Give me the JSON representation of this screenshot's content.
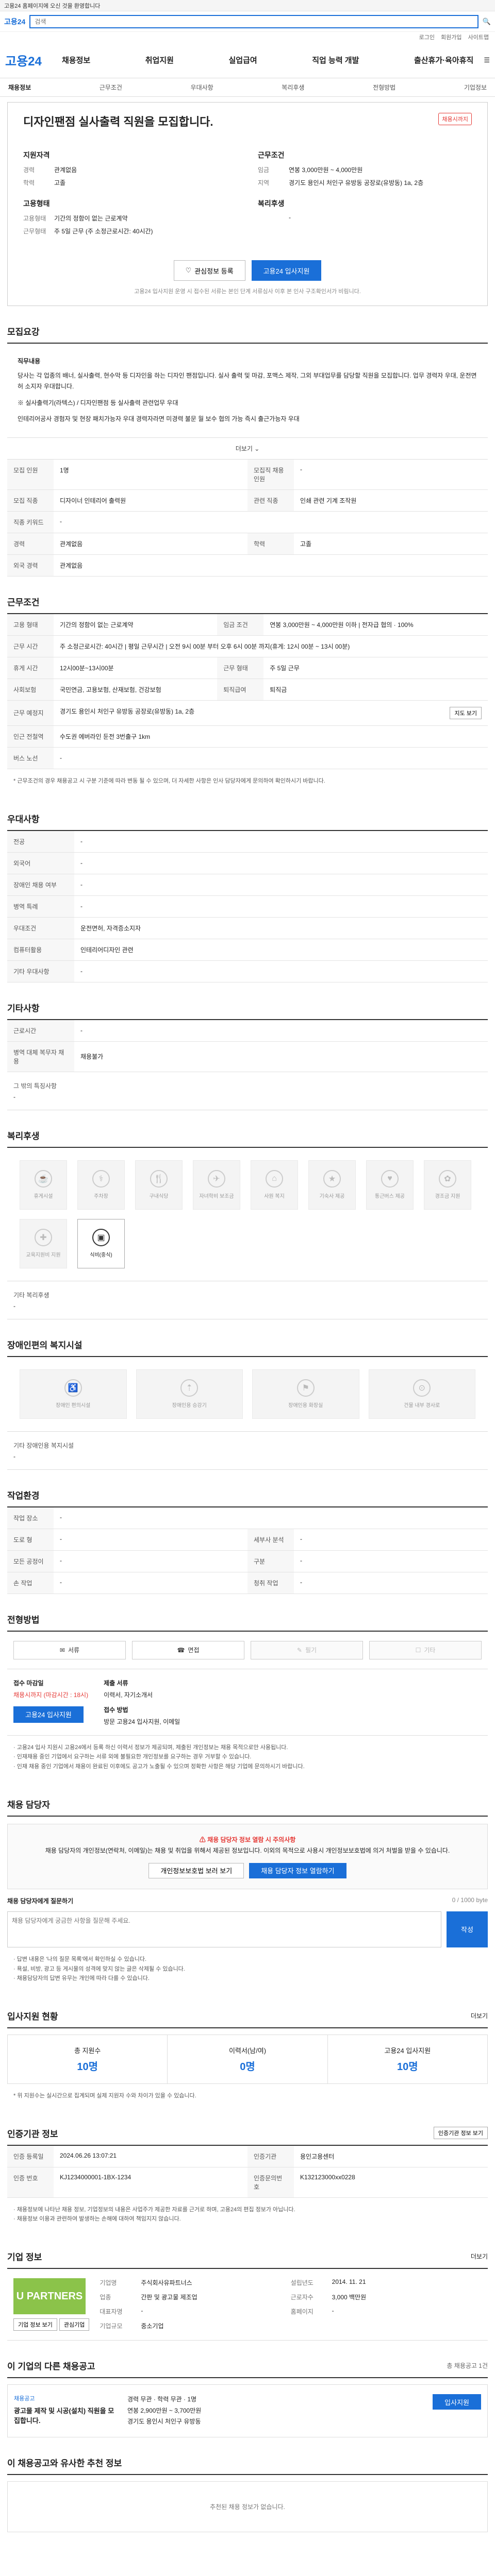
{
  "topbar": {
    "text": "고용24 홈페이지에 오신 것을 환영합니다"
  },
  "search": {
    "logo": "고용24",
    "placeholder": "검색"
  },
  "util": [
    "로그인",
    "회원가입",
    "사이트맵"
  ],
  "gnb": {
    "logo": "고용24",
    "menu": [
      "채용정보",
      "취업지원",
      "실업급여",
      "직업 능력 개발",
      "출산휴가·육아휴직"
    ]
  },
  "lnb": [
    "채용정보",
    "근무조건",
    "우대사항",
    "복리후생",
    "전형방법",
    "기업정보"
  ],
  "hero": {
    "title": "디자인팬점 실사출력 직원을 모집합니다.",
    "badge": "채용시까지",
    "left_title": "지원자격",
    "left": [
      {
        "k": "경력",
        "v": "관계없음"
      },
      {
        "k": "학력",
        "v": "고졸"
      }
    ],
    "left2_title": "고용형태",
    "left2": [
      {
        "k": "고용형태",
        "v": "기간의 정함이 없는 근로계약"
      },
      {
        "k": "근무형태",
        "v": "주 5일 근무 (주 소정근로시간: 40시간)"
      }
    ],
    "right_title": "근무조건",
    "right": [
      {
        "k": "임금",
        "v": "연봉 3,000만원 ~ 4,000만원"
      },
      {
        "k": "지역",
        "v": "경기도 용인시 처인구 유방동 공장로(유방동) 1a, 2층"
      }
    ],
    "right2_title": "복리후생",
    "right2": [
      {
        "k": "",
        "v": "-"
      }
    ],
    "btn_scrap": "관심정보 등록",
    "btn_apply": "고용24 입사지원",
    "note": "고용24 입사지원 운영 시 접수된 서류는 본인 단계 서류심사 이후 본 인사 구조확인서가 비림니다."
  },
  "recruit": {
    "title": "모집요강",
    "duty_label": "직무내용",
    "duty": "당사는 각 업종의 배너, 실사출력, 현수막 등 디자인을 하는 디자인 팬점입니다. 실사 출력 및 마감, 포맥스 제작, 그외 부대업무를 담당할 직원을 모집합니다. 업무 경력자 우대, 운전면허 소지자 우대합니다.",
    "duty2": "※ 실사출력기(라텍스) / 디자인팬점 등 실사출력 관련업무 우대",
    "duty3": "인테리어공사 경험자 및 현장 패치가능자 우대 경력자라면 미경력 불문 월 보수 협의 가능 즉시 출근가능자 우대",
    "more": "더보기",
    "rows": [
      [
        "모집 인원",
        "1명",
        "모집직 채용 인원",
        "-"
      ],
      [
        "모집 직종",
        "디자이너 인테리어 출력원",
        "관련 직종",
        "인쇄 관련 기계 조작원"
      ],
      [
        "직종 키워드",
        "-",
        "",
        ""
      ],
      [
        "경력",
        "관계없음",
        "학력",
        "고졸"
      ],
      [
        "외국 경력",
        "관계없음",
        "",
        ""
      ]
    ]
  },
  "work": {
    "title": "근무조건",
    "rows": [
      {
        "k": "고용 형태",
        "v": "기간의 정함이 없는 근로계약",
        "k2": "임금 조건",
        "v2": "연봉 3,000만원 ~ 4,000만원 이하 | 전자급 협의 · 100%"
      },
      {
        "k": "근무 시간",
        "v": "주 소정근로시간: 40시간 | 평일 근무시간 | 오전 9시 00분 부터 오후 6시 00분 까지(휴게: 12시 00분 ~ 13시 00분)"
      },
      {
        "k": "휴게 시간",
        "v": "12시00분~13시00분",
        "k2": "근무 형태",
        "v2": "주 5일 근무"
      },
      {
        "k": "사회보험",
        "v": "국민연금, 고용보험, 산재보험, 건강보험",
        "k2": "퇴직급여",
        "v2": "퇴직금"
      },
      {
        "k": "근무 예정지",
        "v": "경기도 용인시 처인구 유방동 공장로(유방동) 1a, 2층",
        "btn": "지도 보기"
      },
      {
        "k": "인근 전철역",
        "v": "수도권 에버라인 둔전 3번출구 1km"
      },
      {
        "k": "버스 노선",
        "v": "-"
      }
    ],
    "note": "* 근무조건의 경우 채용공고 시 구분 기준에 따라 변동 될 수 있으며, 더 자세한 사항은 인사 담당자에게 문의하여 확인하시기 바랍니다."
  },
  "pref": {
    "title": "우대사항",
    "rows": [
      [
        "전공",
        "-"
      ],
      [
        "외국어",
        "-"
      ],
      [
        "장애인 채용 여부",
        "-"
      ],
      [
        "병역 특례",
        "-"
      ],
      [
        "우대조건",
        "운전면허, 자격증소지자"
      ],
      [
        "컴퓨터활용",
        "인테리어디자인 관련"
      ],
      [
        "기타 우대사항",
        "-"
      ]
    ]
  },
  "etc": {
    "title": "기타사항",
    "rows": [
      [
        "근로시간",
        "-"
      ],
      [
        "병역 대체 복무자 채용",
        "채용불가"
      ],
      [
        "그 밖의 특징사항",
        "-"
      ]
    ]
  },
  "welfare": {
    "title": "복리후생",
    "tiles": [
      {
        "icon": "☕",
        "label": "휴게시설"
      },
      {
        "icon": "⚕",
        "label": "주차장"
      },
      {
        "icon": "🍴",
        "label": "구내식당"
      },
      {
        "icon": "✈",
        "label": "자녀학비 보조금"
      },
      {
        "icon": "⌂",
        "label": "사원 복지"
      },
      {
        "icon": "★",
        "label": "기숙사 제공"
      },
      {
        "icon": "♥",
        "label": "통근버스 제공"
      },
      {
        "icon": "✿",
        "label": "경조금 지원"
      },
      {
        "icon": "✚",
        "label": "교육지원비 지원"
      },
      {
        "icon": "▣",
        "label": "식비(중식)"
      }
    ],
    "active_index": 9,
    "other_label": "기타 복리후생",
    "other": "-"
  },
  "disability": {
    "title": "장애인편의 복지시설",
    "tiles": [
      {
        "icon": "♿",
        "label": "장애인 편의시설"
      },
      {
        "icon": "⇡",
        "label": "장애인용 승강기"
      },
      {
        "icon": "⚑",
        "label": "장애인용 화장실"
      },
      {
        "icon": "⊙",
        "label": "건물 내부 경사로"
      }
    ],
    "other_label": "기타 장애인용 복지시설",
    "other": "-"
  },
  "work_env": {
    "title": "작업환경",
    "rows": [
      [
        "작업 장소",
        "-",
        "",
        ""
      ],
      [
        "도로 형",
        "-",
        "세부사 분석",
        "-"
      ],
      [
        "모든 공정이",
        "-",
        "구분",
        "-"
      ],
      [
        "손 작업",
        "-",
        "청취 작업",
        "-"
      ]
    ]
  },
  "selection": {
    "title": "전형방법",
    "methods": [
      {
        "icon": "✉",
        "label": "서류"
      },
      {
        "icon": "☎",
        "label": "면접"
      },
      {
        "icon": "✎",
        "label": "필기"
      },
      {
        "icon": "☐",
        "label": "기타"
      }
    ],
    "deadline_label": "접수 마감일",
    "deadline": "채용시까지 (마감시간 : 18시)",
    "docs_label": "제출 서류",
    "docs": "이력서, 자기소개서",
    "method_label": "접수 방법",
    "method": "방문 고용24 입사지원, 이메일",
    "btn": "고용24 입사지원",
    "notes": [
      "· 고용24 입사 지원시 고용24에서 등록 하신 이력서 정보가 제공되며, 제출된 개인정보는 채용 목적으로만 사용됩니다.",
      "· 인재채용 중인 기업에서 요구하는 서류 외에 불필요한 개인정보를 요구하는 경우 거부할 수 있습니다.",
      "· 인재 채용 중인 기업에서 채용이 완료된 이후에도 공고가 노출될 수 있으며 정확한 사항은 해당 기업에 문의하시기 바랍니다."
    ]
  },
  "qa": {
    "title": "채용 담당자",
    "warn_title": "채용 담당자 정보 열람 시 주의사항",
    "warn": "채용 담당자의 개인정보(연락처, 이메일)는 채용 및 취업을 위해서 제공된 정보입니다. 이외의 목적으로 사용시 개인정보보호법에 의거 처벌을 받을 수 있습니다.",
    "btn_agree": "개인정보보호법 보러 보기",
    "btn_view": "채용 담당자 정보 열람하기",
    "form_title": "채용 담당자에게 질문하기",
    "form_counter": "0 / 1000 byte",
    "form_placeholder": "채용 담당자에게 궁금한 사항을 질문해 주세요.",
    "submit": "작성",
    "notes": [
      "· 답변 내용은 '나의 질문 목록'에서 확인하실 수 있습니다.",
      "· 욕설, 비방, 광고 등 게시물의 성격에 맞지 않는 글은 삭제될 수 있습니다.",
      "· 채용담당자의 답변 유무는 개인에 따라 다를 수 있습니다."
    ]
  },
  "status": {
    "title": "입사지원 현황",
    "more": "더보기",
    "items": [
      {
        "label": "총 지원수",
        "value": "10명"
      },
      {
        "label": "이력서(남/여)",
        "value": "0명"
      },
      {
        "label": "고용24 입사지원",
        "value": "10명"
      }
    ],
    "note": "* 위 지원수는 실시간으로 집계되며 실제 지원자 수와 차이가 있을 수 있습니다."
  },
  "registration": {
    "title": "인증기관 정보",
    "btn": "인증기관 정보 보기",
    "rows": [
      [
        "인증 등록일",
        "2024.06.26 13:07:21",
        "인증기관",
        "용인고용센터"
      ],
      [
        "인증 번호",
        "KJ1234000001-1BX-1234",
        "인증문의번호",
        "K132123000xx0228"
      ]
    ],
    "notes": [
      "· 채용정보에 나타난 채용 정보, 기업정보의 내용은 사업주가 제공한 자료를 근거로 하며, 고용24의 편집 정보가 아닙니다.",
      "· 채용정보 이용과 관련하여 발생하는 손해에 대하여 책임지지 않습니다."
    ]
  },
  "company": {
    "title": "기업 정보",
    "more": "더보기",
    "logo": "U PARTNERS",
    "btn_a": "기업 정보 보기",
    "btn_b": "관심기업",
    "rows": [
      [
        "기업명",
        "주식회사유파트너스",
        "설립년도",
        "2014. 11. 21"
      ],
      [
        "업종",
        "간판 및 광고물 제조업",
        "근로자수",
        "3,000 백만원"
      ],
      [
        "대표자명",
        "-",
        "홈페이지",
        "-"
      ],
      [
        "기업규모",
        "중소기업",
        "",
        ""
      ]
    ]
  },
  "other_jobs": {
    "title": "이 기업의 다른 채용공고",
    "count_label": "총 채용공고 1건",
    "job_logo": "채용공고",
    "job_title": "광고물 제작 및 시공(설치) 직원을 모집합니다.",
    "job_meta": [
      "경력 무관 · 학력 무관 · 1명",
      "연봉 2,900만원 ~ 3,700만원",
      "경기도 용인시 처인구 유방동"
    ],
    "btn": "입사지원"
  },
  "recommend": {
    "title": "이 채용공고와 유사한 추천 정보",
    "empty": "추천된 채용 정보가 없습니다."
  }
}
